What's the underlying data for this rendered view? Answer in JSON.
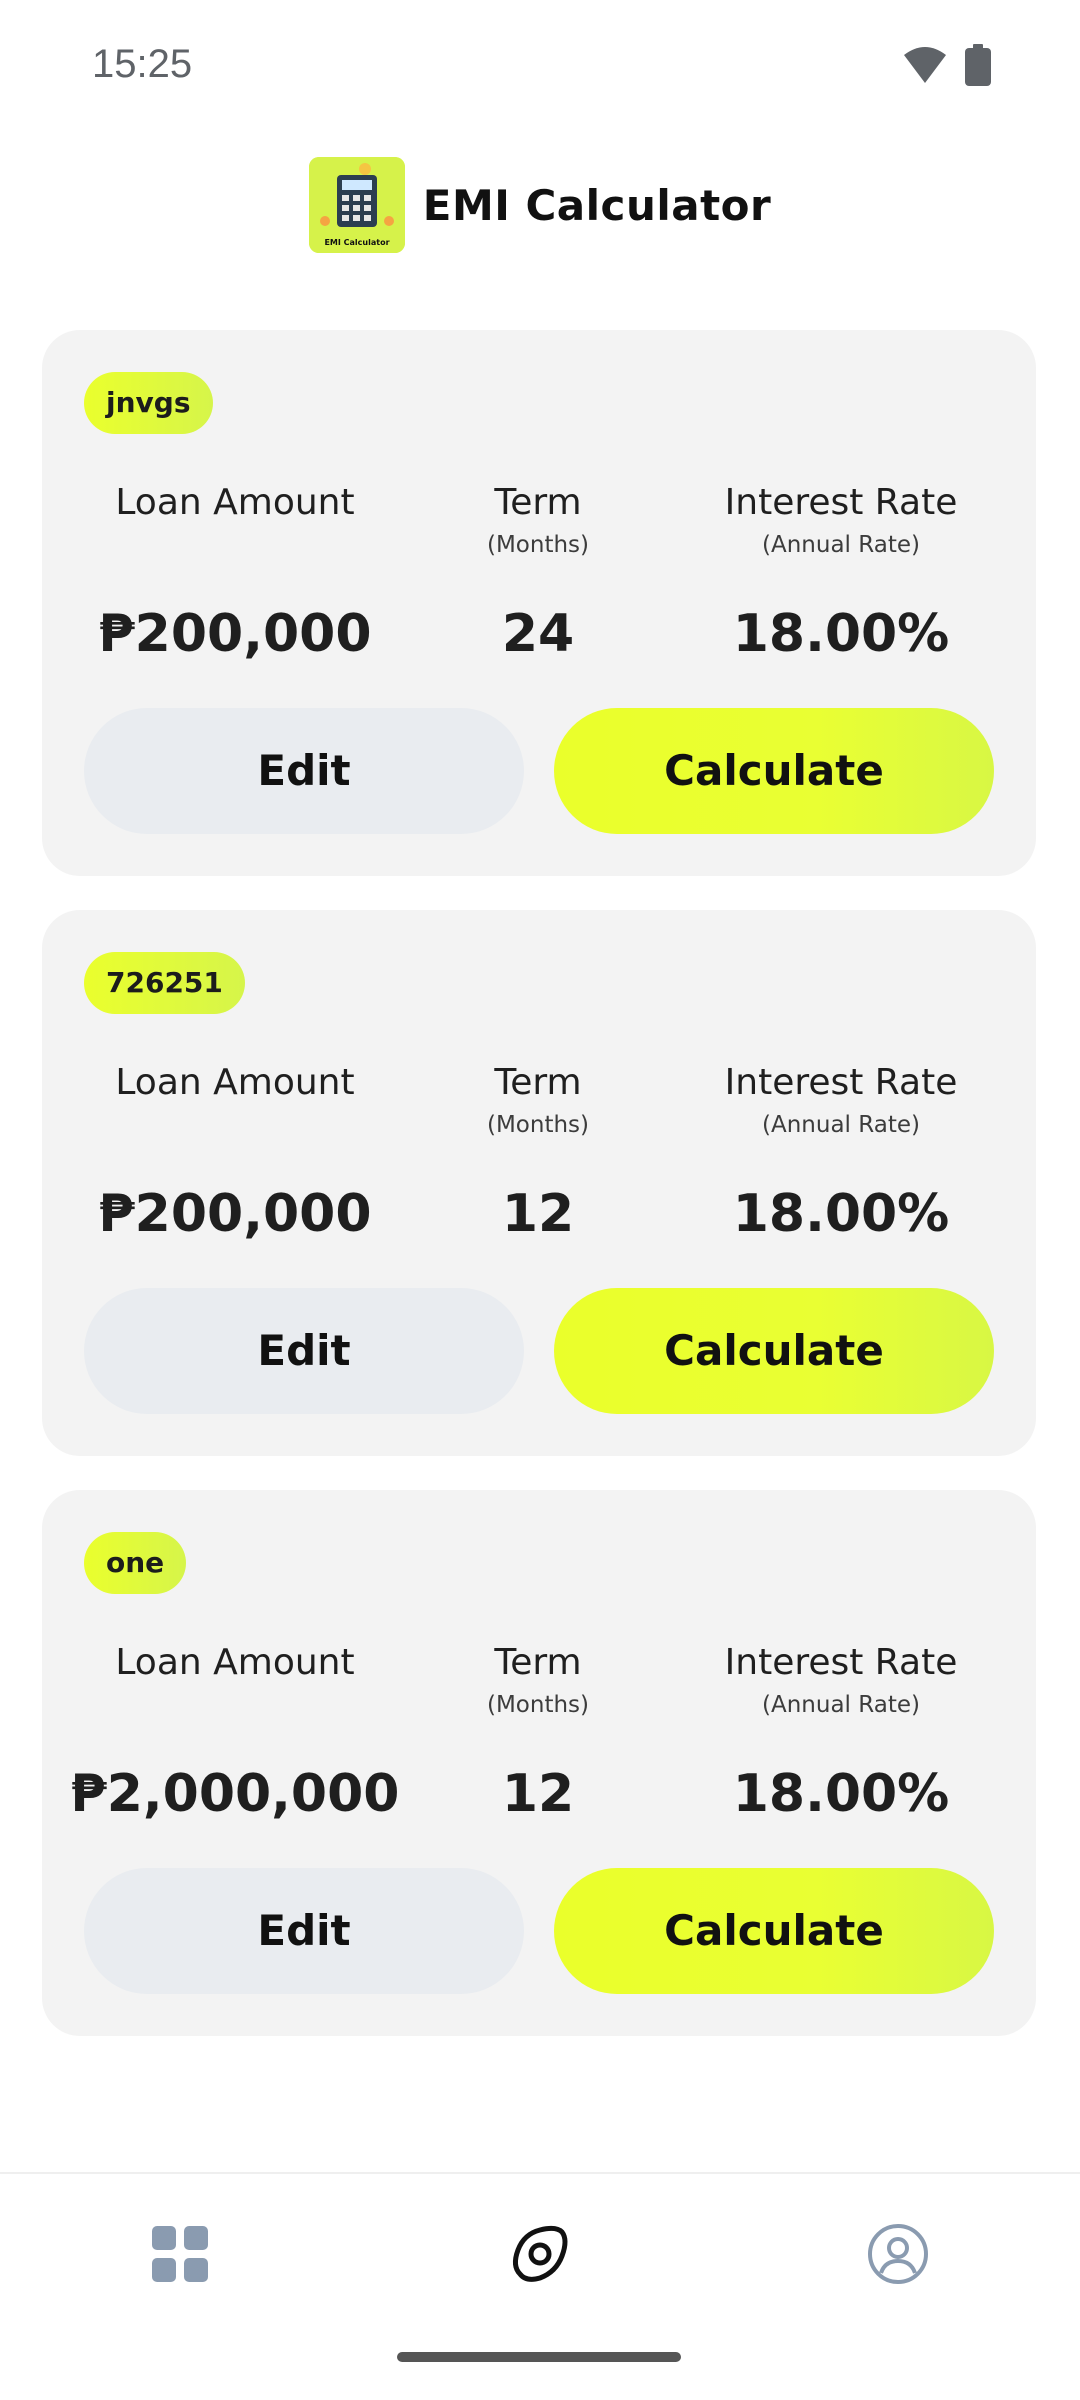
{
  "status_bar": {
    "time": "15:25"
  },
  "header": {
    "title": "EMI Calculator",
    "logo_caption": "EMI Calculator"
  },
  "columns": {
    "loan_amount_label": "Loan Amount",
    "term_label": "Term",
    "term_sub": "(Months)",
    "rate_label": "Interest Rate",
    "rate_sub": "(Annual Rate)"
  },
  "buttons": {
    "edit_label": "Edit",
    "calculate_label": "Calculate"
  },
  "loans": [
    {
      "name": "jnvgs",
      "amount": "₱200,000",
      "term": "24",
      "rate": "18.00%"
    },
    {
      "name": "726251",
      "amount": "₱200,000",
      "term": "12",
      "rate": "18.00%"
    },
    {
      "name": "one",
      "amount": "₱2,000,000",
      "term": "12",
      "rate": "18.00%"
    }
  ],
  "bottom_nav": {
    "items": [
      "grid-icon",
      "compass-icon",
      "profile-icon"
    ],
    "active": "compass-icon"
  },
  "colors": {
    "accent": "#eaff2d",
    "card_bg": "#f3f3f3",
    "edit_bg": "#e9ecf0",
    "nav_inactive": "#8a9bb0"
  }
}
